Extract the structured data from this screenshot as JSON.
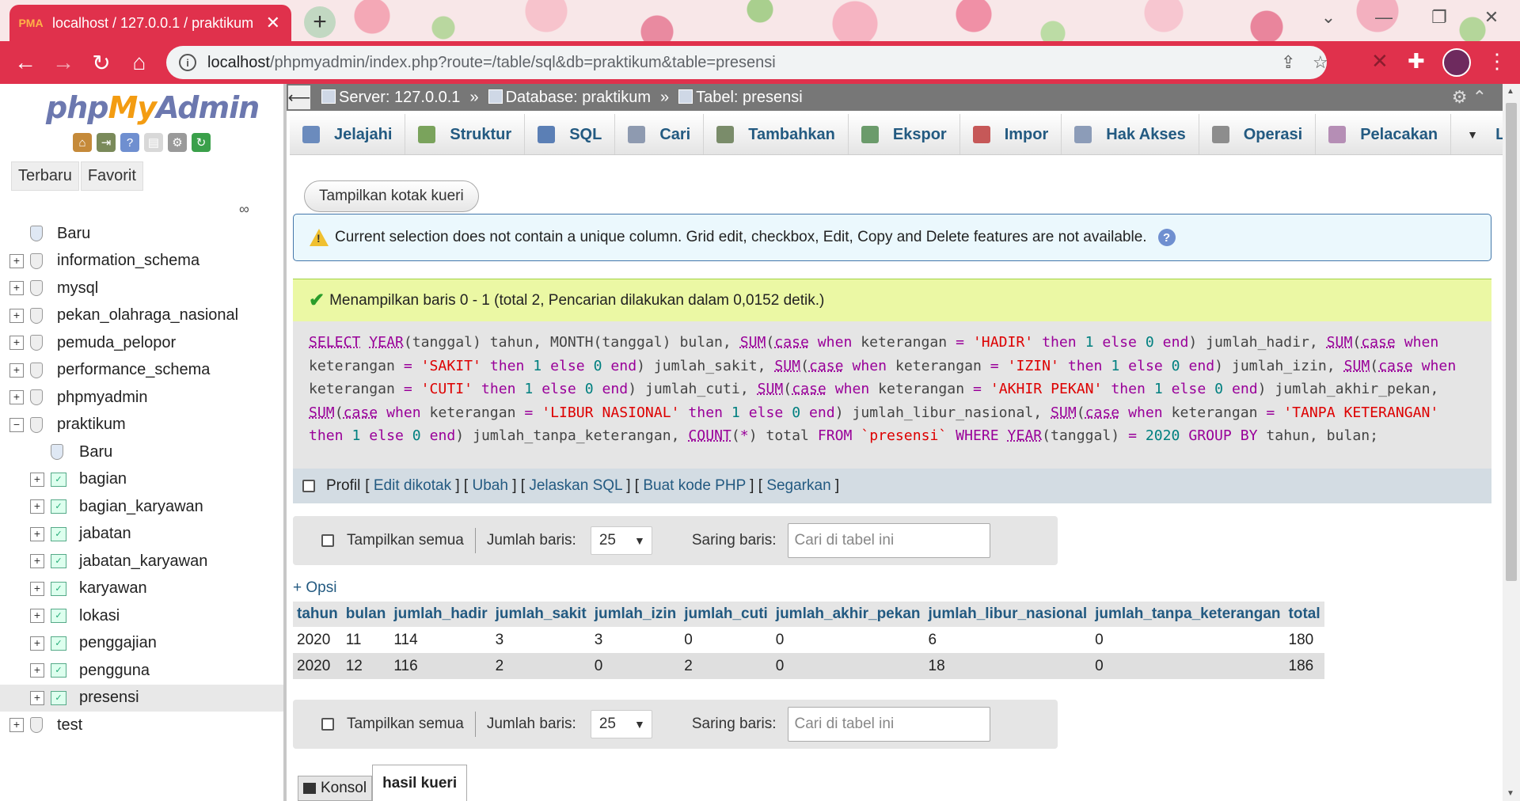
{
  "browser": {
    "tab_title": "localhost / 127.0.0.1 / praktikum",
    "tab_favicon": "PMA",
    "url_host": "localhost",
    "url_path": "/phpmyadmin/index.php?route=/table/sql&db=praktikum&table=presensi"
  },
  "nav": {
    "logo_php": "php",
    "logo_my": "My",
    "logo_admin": "Admin",
    "recent_tab": "Terbaru",
    "favorite_tab": "Favorit",
    "tree": [
      {
        "label": "Baru",
        "kind": "new",
        "level": 0
      },
      {
        "label": "information_schema",
        "kind": "db",
        "level": 0
      },
      {
        "label": "mysql",
        "kind": "db",
        "level": 0
      },
      {
        "label": "pekan_olahraga_nasional",
        "kind": "db",
        "level": 0
      },
      {
        "label": "pemuda_pelopor",
        "kind": "db",
        "level": 0
      },
      {
        "label": "performance_schema",
        "kind": "db",
        "level": 0
      },
      {
        "label": "phpmyadmin",
        "kind": "db",
        "level": 0
      },
      {
        "label": "praktikum",
        "kind": "db-open",
        "level": 0
      },
      {
        "label": "Baru",
        "kind": "new",
        "level": 1
      },
      {
        "label": "bagian",
        "kind": "table",
        "level": 1
      },
      {
        "label": "bagian_karyawan",
        "kind": "table",
        "level": 1
      },
      {
        "label": "jabatan",
        "kind": "table",
        "level": 1
      },
      {
        "label": "jabatan_karyawan",
        "kind": "table",
        "level": 1
      },
      {
        "label": "karyawan",
        "kind": "table",
        "level": 1
      },
      {
        "label": "lokasi",
        "kind": "table",
        "level": 1
      },
      {
        "label": "penggajian",
        "kind": "table",
        "level": 1
      },
      {
        "label": "pengguna",
        "kind": "table",
        "level": 1
      },
      {
        "label": "presensi",
        "kind": "table",
        "level": 1,
        "selected": true
      },
      {
        "label": "test",
        "kind": "db",
        "level": 0
      }
    ]
  },
  "breadcrumb": {
    "server": "Server: 127.0.0.1",
    "database": "Database: praktikum",
    "table": "Tabel: presensi",
    "separator": "»"
  },
  "menu": [
    {
      "label": "Jelajahi",
      "icon": "browse-icon",
      "color": "#6b8bbd"
    },
    {
      "label": "Struktur",
      "icon": "structure-icon",
      "color": "#7aa35c"
    },
    {
      "label": "SQL",
      "icon": "sql-icon",
      "color": "#5b7fb5"
    },
    {
      "label": "Cari",
      "icon": "search-icon",
      "color": "#8e9ab0"
    },
    {
      "label": "Tambahkan",
      "icon": "insert-icon",
      "color": "#7a8c6a"
    },
    {
      "label": "Ekspor",
      "icon": "export-icon",
      "color": "#6b9b6b"
    },
    {
      "label": "Impor",
      "icon": "import-icon",
      "color": "#c65858"
    },
    {
      "label": "Hak Akses",
      "icon": "privileges-icon",
      "color": "#8c9cb8"
    },
    {
      "label": "Operasi",
      "icon": "wrench-icon",
      "color": "#8d8d8d"
    },
    {
      "label": "Pelacakan",
      "icon": "eye-icon",
      "color": "#b58eb5"
    },
    {
      "label": "Lai",
      "icon": "chevron-down-icon",
      "color": "#333333"
    }
  ],
  "query_button": "Tampilkan kotak kueri",
  "notice_text": "Current selection does not contain a unique column. Grid edit, checkbox, Edit, Copy and Delete features are not available.",
  "success_text": "Menampilkan baris 0 - 1 (total 2, Pencarian dilakukan dalam 0,0152 detik.)",
  "profile": {
    "label": "Profil",
    "links": [
      "Edit dikotak",
      "Ubah",
      "Jelaskan SQL",
      "Buat kode PHP",
      "Segarkan"
    ]
  },
  "rows_nav": {
    "show_all": "Tampilkan semua",
    "rows_label": "Jumlah baris:",
    "rows_value": "25",
    "filter_label": "Saring baris:",
    "filter_placeholder": "Cari di tabel ini"
  },
  "options_link": "+ Opsi",
  "table": {
    "columns": [
      "tahun",
      "bulan",
      "jumlah_hadir",
      "jumlah_sakit",
      "jumlah_izin",
      "jumlah_cuti",
      "jumlah_akhir_pekan",
      "jumlah_libur_nasional",
      "jumlah_tanpa_keterangan",
      "total"
    ],
    "rows": [
      [
        "2020",
        "11",
        "114",
        "3",
        "3",
        "0",
        "0",
        "6",
        "0",
        "180"
      ],
      [
        "2020",
        "12",
        "116",
        "2",
        "0",
        "2",
        "0",
        "18",
        "0",
        "186"
      ]
    ]
  },
  "console": {
    "konsol": "Konsol",
    "hasil": "hasil kueri"
  },
  "colors": {
    "chrome_accent": "#e0314c",
    "link": "#235a81",
    "success_bg": "#ebf8a4",
    "notice_bg": "#ebf8fd"
  }
}
